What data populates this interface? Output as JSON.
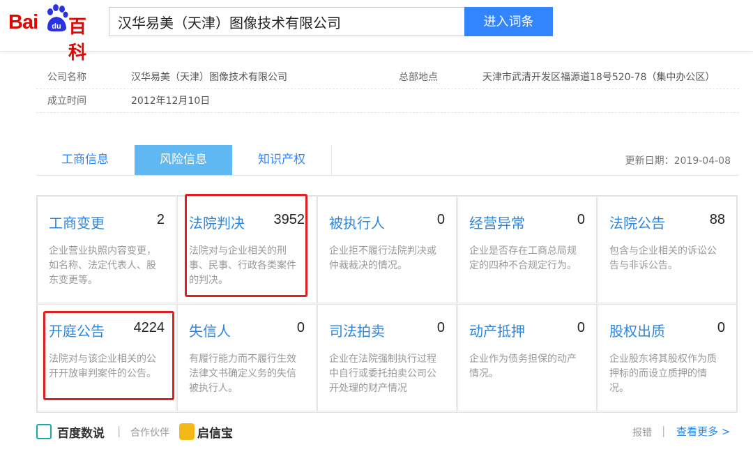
{
  "header": {
    "logo_bai": "Bai",
    "logo_du": "du",
    "logo_baike": "百科",
    "search_value": "汉华易美（天津）图像技术有限公司",
    "search_button": "进入词条",
    "accent_color": "#3385ff",
    "logo_color": "#e10601"
  },
  "info": {
    "company_label": "公司名称",
    "company_value": "汉华易美（天津）图像技术有限公司",
    "hq_label": "总部地点",
    "hq_value": "天津市武清开发区福源道18号520-78（集中办公区）",
    "founded_label": "成立时间",
    "founded_value": "2012年12月10日"
  },
  "tabs": [
    {
      "label": "工商信息",
      "active": false
    },
    {
      "label": "风险信息",
      "active": true
    },
    {
      "label": "知识产权",
      "active": false
    }
  ],
  "update_date": "更新日期：2019-04-08",
  "risk_cards": [
    {
      "title": "工商变更",
      "count": "2",
      "desc": "企业营业执照内容变更，如名称、法定代表人、股东变更等。",
      "highlighted": false
    },
    {
      "title": "法院判决",
      "count": "3952",
      "desc": "法院对与企业相关的刑事、民事、行政各类案件的判决。",
      "highlighted": true
    },
    {
      "title": "被执行人",
      "count": "0",
      "desc": "企业拒不履行法院判决或仲裁裁决的情况。",
      "highlighted": false
    },
    {
      "title": "经营异常",
      "count": "0",
      "desc": "企业是否存在工商总局规定的四种不合规定行为。",
      "highlighted": false
    },
    {
      "title": "法院公告",
      "count": "88",
      "desc": "包含与企业相关的诉讼公告与非诉公告。",
      "highlighted": false
    },
    {
      "title": "开庭公告",
      "count": "4224",
      "desc": "法院对与该企业相关的公开开放审判案件的公告。",
      "highlighted": true
    },
    {
      "title": "失信人",
      "count": "0",
      "desc": "有履行能力而不履行生效法律文书确定义务的失信被执行人。",
      "highlighted": false
    },
    {
      "title": "司法拍卖",
      "count": "0",
      "desc": "企业在法院强制执行过程中自行或委托拍卖公司公开处理的财产情况",
      "highlighted": false
    },
    {
      "title": "动产抵押",
      "count": "0",
      "desc": "企业作为债务担保的动产情况。",
      "highlighted": false
    },
    {
      "title": "股权出质",
      "count": "0",
      "desc": "企业股东将其股权作为质押标的而设立质押的情况。",
      "highlighted": false
    }
  ],
  "footer": {
    "brand": "百度数说",
    "separator": "|",
    "partner_label": "合作伙伴",
    "partner_name": "启信宝",
    "report": "报错",
    "more": "查看更多 >"
  }
}
